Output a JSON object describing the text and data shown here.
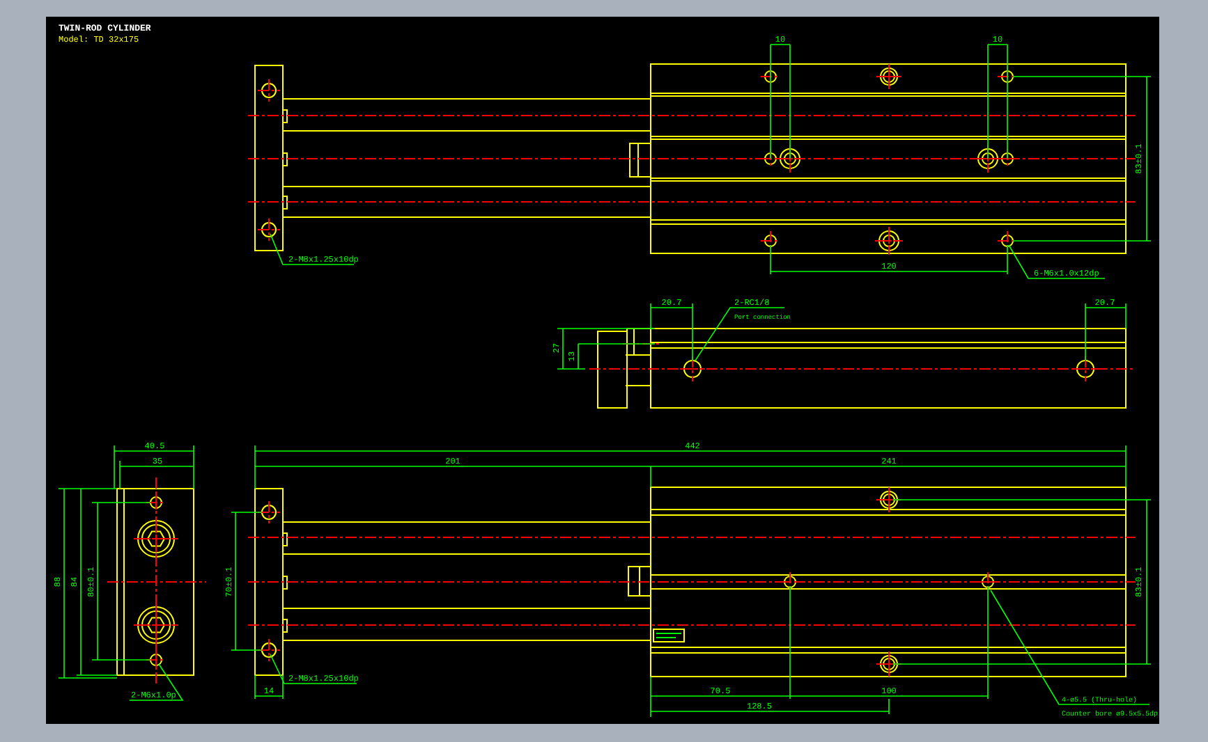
{
  "drawing": {
    "title": "TWIN-ROD CYLINDER",
    "model": "Model: TD 32x175"
  },
  "top_view": {
    "labels": [
      "2-M8x1.25x10dp",
      "10",
      "10",
      "83±0.1",
      "120",
      "6-M6x1.0x12dp"
    ]
  },
  "side_view": {
    "labels": [
      "20.7",
      "2-RC1/8",
      "Port connection",
      "20.7",
      "27",
      "13"
    ]
  },
  "end_view": {
    "labels": [
      "40.5",
      "35",
      "88",
      "84",
      "80±0.1",
      "2-M6x1.0p"
    ]
  },
  "front_view": {
    "labels": [
      "442",
      "201",
      "241",
      "70±0.1",
      "14",
      "2-M8x1.25x10dp",
      "83±0.1",
      "70.5",
      "100",
      "128.5",
      "4-ø5.5 (Thru-hole)",
      "Counter bore ø9.5x5.5dp"
    ]
  }
}
